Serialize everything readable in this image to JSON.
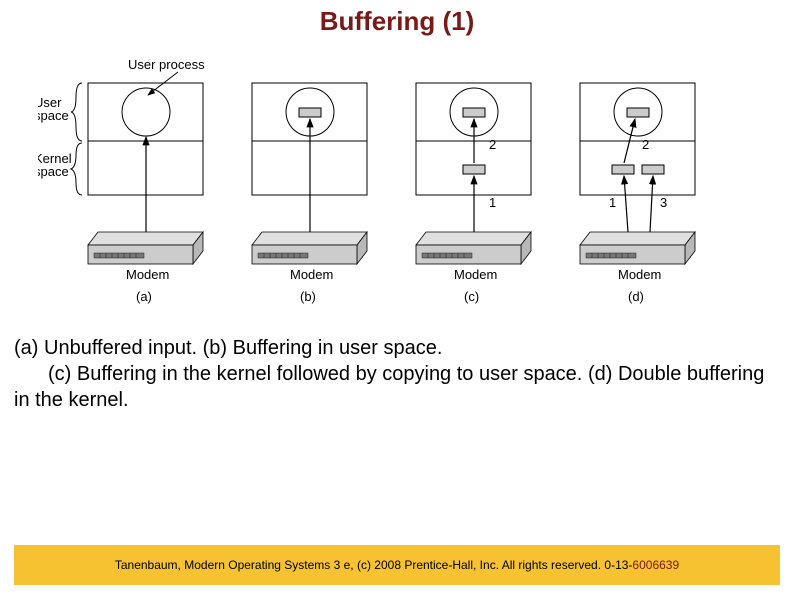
{
  "title": "Buffering (1)",
  "labels": {
    "user_process": "User process",
    "user_space": "User\nspace",
    "kernel_space": "Kernel\nspace",
    "modem": "Modem"
  },
  "variants": [
    {
      "id": "a",
      "label": "(a)"
    },
    {
      "id": "b",
      "label": "(b)"
    },
    {
      "id": "c",
      "label": "(c)",
      "annot": {
        "step1": "1",
        "step2": "2"
      }
    },
    {
      "id": "d",
      "label": "(d)",
      "annot": {
        "step1": "1",
        "step2": "2",
        "step3": "3"
      }
    }
  ],
  "caption": {
    "a": "(a) Unbuffered input.",
    "b": "(b) Buffering in user space.",
    "c": "(c) Buffering in the kernel followed by copying to user space.",
    "d": "(d) Double buffering in the kernel."
  },
  "footer": {
    "citation": "Tanenbaum, Modern Operating Systems 3 e, (c) 2008 Prentice-Hall, Inc. All rights reserved. 0-13-",
    "isbn_suffix": "6006639"
  }
}
